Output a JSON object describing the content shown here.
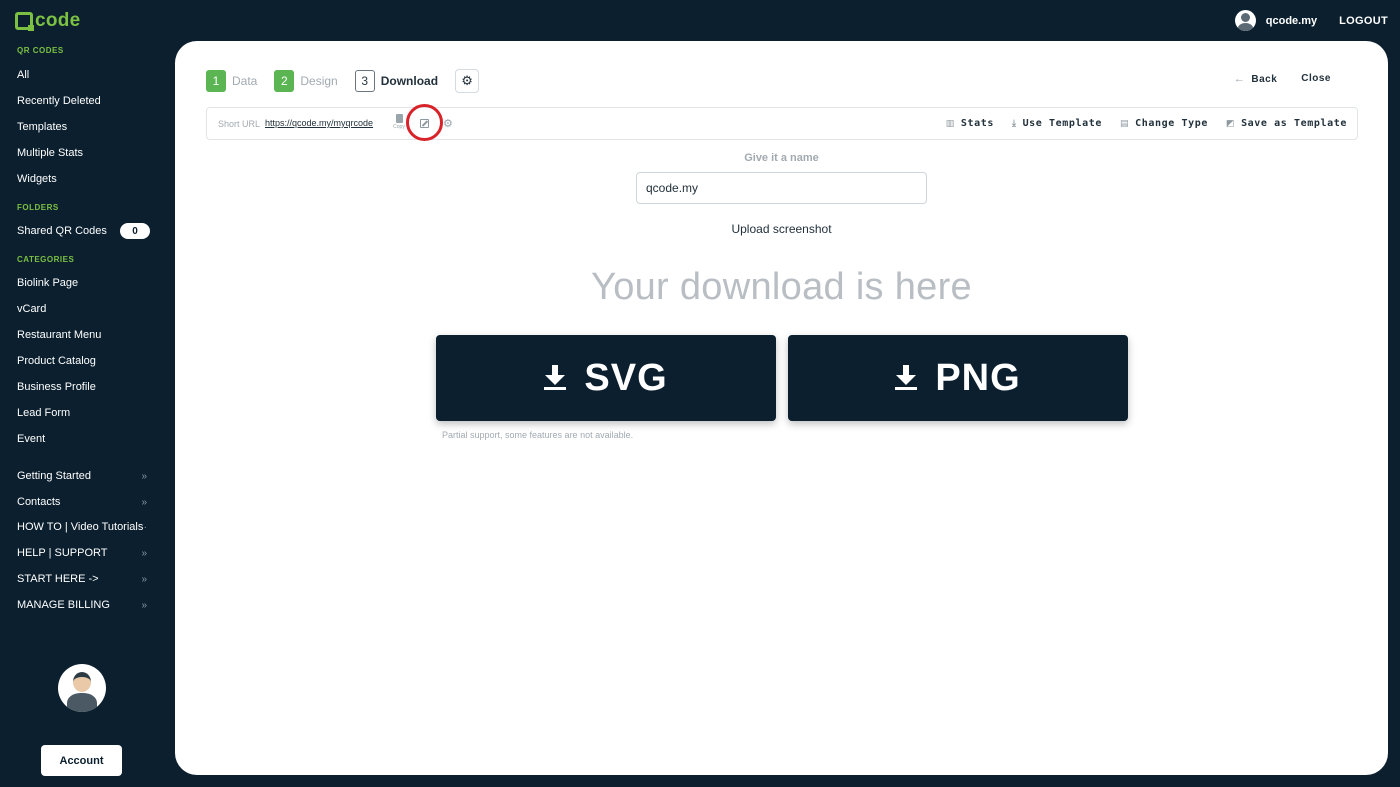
{
  "app": {
    "logo_text": "code",
    "brand_color": "#7bc043"
  },
  "topbar": {
    "username": "qcode.my",
    "logout_label": "LOGOUT"
  },
  "sidebar": {
    "qr_section_title": "QR CODES",
    "qr_items": [
      "All",
      "Recently Deleted",
      "Templates",
      "Multiple Stats",
      "Widgets"
    ],
    "folders_title": "FOLDERS",
    "shared_label": "Shared QR Codes",
    "shared_count": "0",
    "categories_title": "CATEGORIES",
    "categories": [
      "Biolink Page",
      "vCard",
      "Restaurant Menu",
      "Product Catalog",
      "Business Profile",
      "Lead Form",
      "Event"
    ],
    "links": [
      "Getting Started",
      "Contacts",
      "HOW TO | Video Tutorials",
      "HELP | SUPPORT",
      "START HERE ->",
      "MANAGE BILLING"
    ],
    "account_label": "Account"
  },
  "steps": [
    {
      "num": "1",
      "label": "Data"
    },
    {
      "num": "2",
      "label": "Design"
    },
    {
      "num": "3",
      "label": "Download"
    }
  ],
  "top_actions": {
    "back": "Back",
    "close": "Close"
  },
  "urlbar": {
    "label": "Short URL",
    "url": "https://qcode.my/myqrcode",
    "copy_label": "Copy",
    "actions": [
      "Stats",
      "Use Template",
      "Change Type",
      "Save as Template"
    ]
  },
  "name": {
    "label": "Give it a name",
    "value": "qcode.my"
  },
  "upload_label": "Upload screenshot",
  "headline": "Your download is here",
  "downloads": {
    "svg": "SVG",
    "png": "PNG"
  },
  "note": "Partial support, some features are not available.",
  "colors": {
    "navy": "#0b1f2e",
    "step_done": "#5ab552",
    "highlight": "#d8232a"
  }
}
